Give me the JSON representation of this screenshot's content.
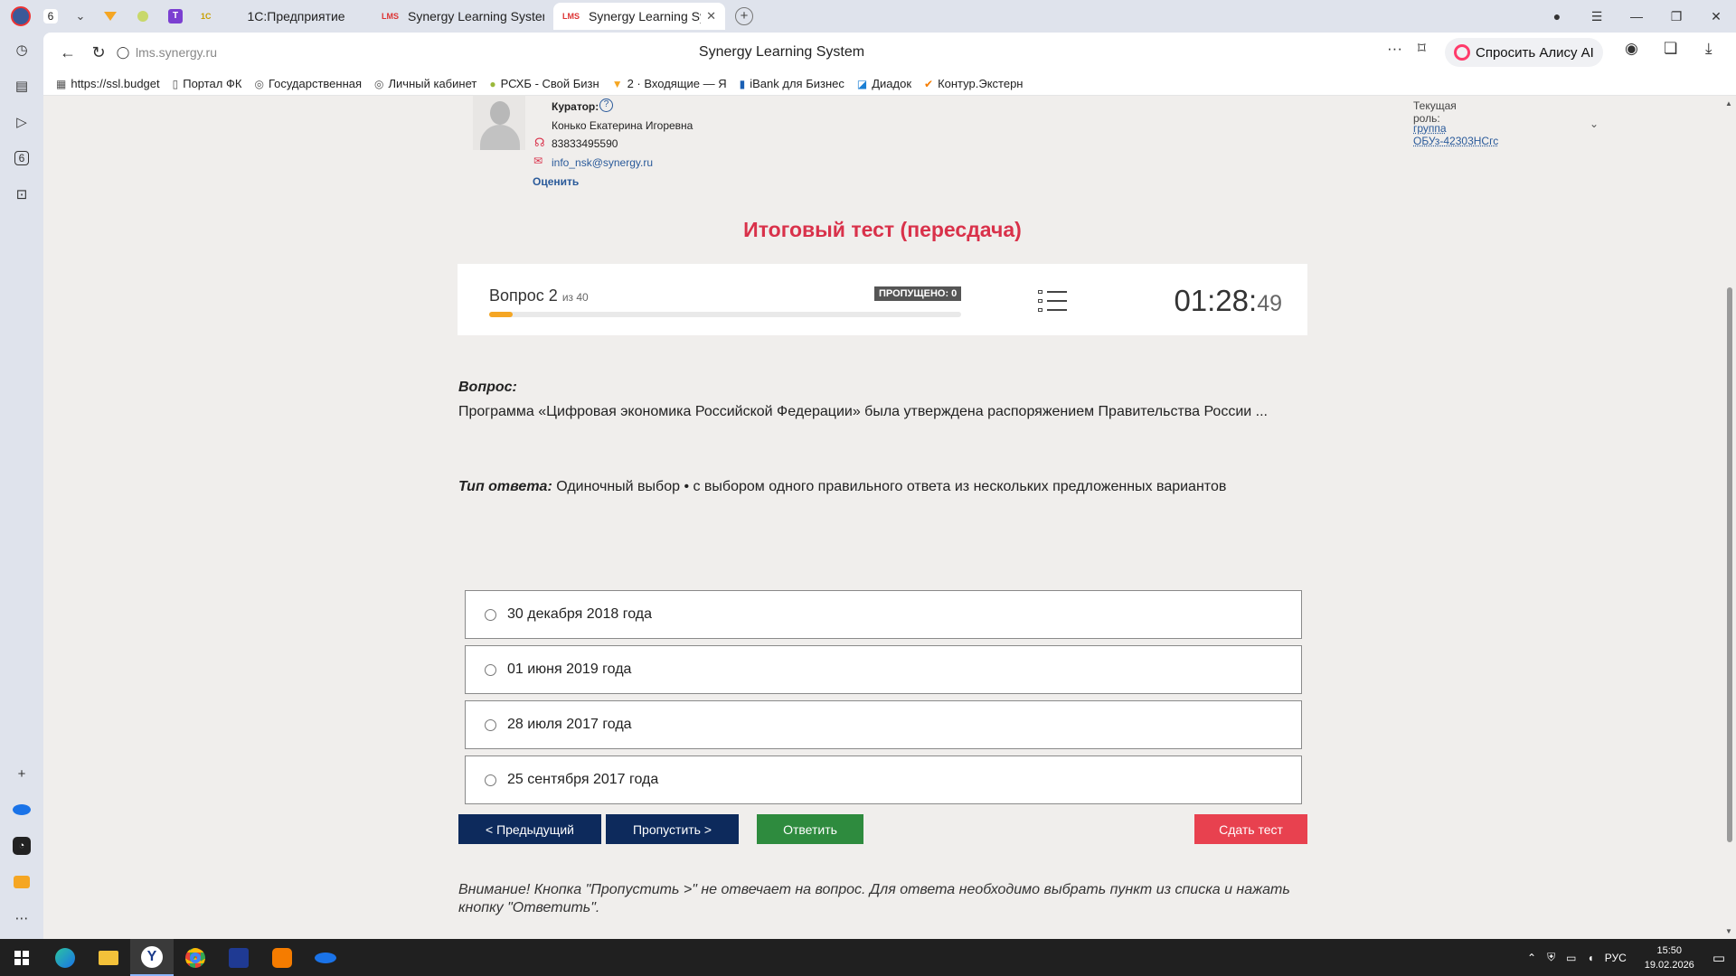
{
  "tabs": [
    {
      "label": "1С:Предприятие"
    },
    {
      "label": "Synergy Learning System"
    },
    {
      "label": "Synergy Learning Syste"
    }
  ],
  "tab_badge": "6",
  "tab_fav_lms": "LMS",
  "tab_fav_1c": "1С",
  "tab_fav_t": "T",
  "leftbar_badge": "6",
  "url": "lms.synergy.ru",
  "page_title": "Synergy Learning System",
  "alice_label": "Спросить Алису AI",
  "bookmarks": [
    {
      "label": "https://ssl.budget"
    },
    {
      "label": "Портал ФК"
    },
    {
      "label": "Государственная"
    },
    {
      "label": "Личный кабинет"
    },
    {
      "label": "РСХБ - Свой Бизн"
    },
    {
      "label": "2 · Входящие — Я"
    },
    {
      "label": "iBank для Бизнес"
    },
    {
      "label": "Диадок"
    },
    {
      "label": "Контур.Экстерн"
    }
  ],
  "curator": {
    "label": "Куратор:",
    "name": "Конько Екатерина Игоревна",
    "phone": "83833495590",
    "email": "info_nsk@synergy.ru",
    "rate": "Оценить"
  },
  "role": {
    "label": "Текущая роль:",
    "value": "группа ОБУз-42303НСгс"
  },
  "test": {
    "title": "Итоговый тест (пересдача)",
    "question_prefix": "Вопрос 2",
    "question_of": "из 40",
    "skipped": "ПРОПУЩЕНО: 0",
    "progress": 0.05,
    "progress_color": "#f5a623",
    "timer_main": "01:28:",
    "timer_sec": "49",
    "question_label": "Вопрос:",
    "question_text": "Программа «Цифровая экономика Российской Федерации» была утверждена распоряжением Правительства России ...",
    "answer_type_label": "Тип ответа:",
    "answer_type_text": " Одиночный выбор • с выбором одного правильного ответа из нескольких предложенных вариантов",
    "options": [
      {
        "label": "30 декабря 2018 года"
      },
      {
        "label": "01 июня 2019 года"
      },
      {
        "label": "28 июля 2017 года"
      },
      {
        "label": "25 сентября 2017 года"
      }
    ],
    "buttons": {
      "prev": "< Предыдущий",
      "skip": "Пропустить >",
      "answer": "Ответить",
      "submit": "Сдать тест"
    },
    "warning": "Внимание! Кнопка \"Пропустить >\" не отвечает на вопрос. Для ответа необходимо выбрать пункт из списка и нажать кнопку \"Ответить\"."
  },
  "colors": {
    "accent_red": "#d9314a",
    "nav_button": "#0d2a5c",
    "answer_button": "#2e8b3e",
    "submit_button": "#e8414f"
  },
  "tray": {
    "lang": "РУС",
    "time": "15:50",
    "date": "19.02.2026"
  }
}
